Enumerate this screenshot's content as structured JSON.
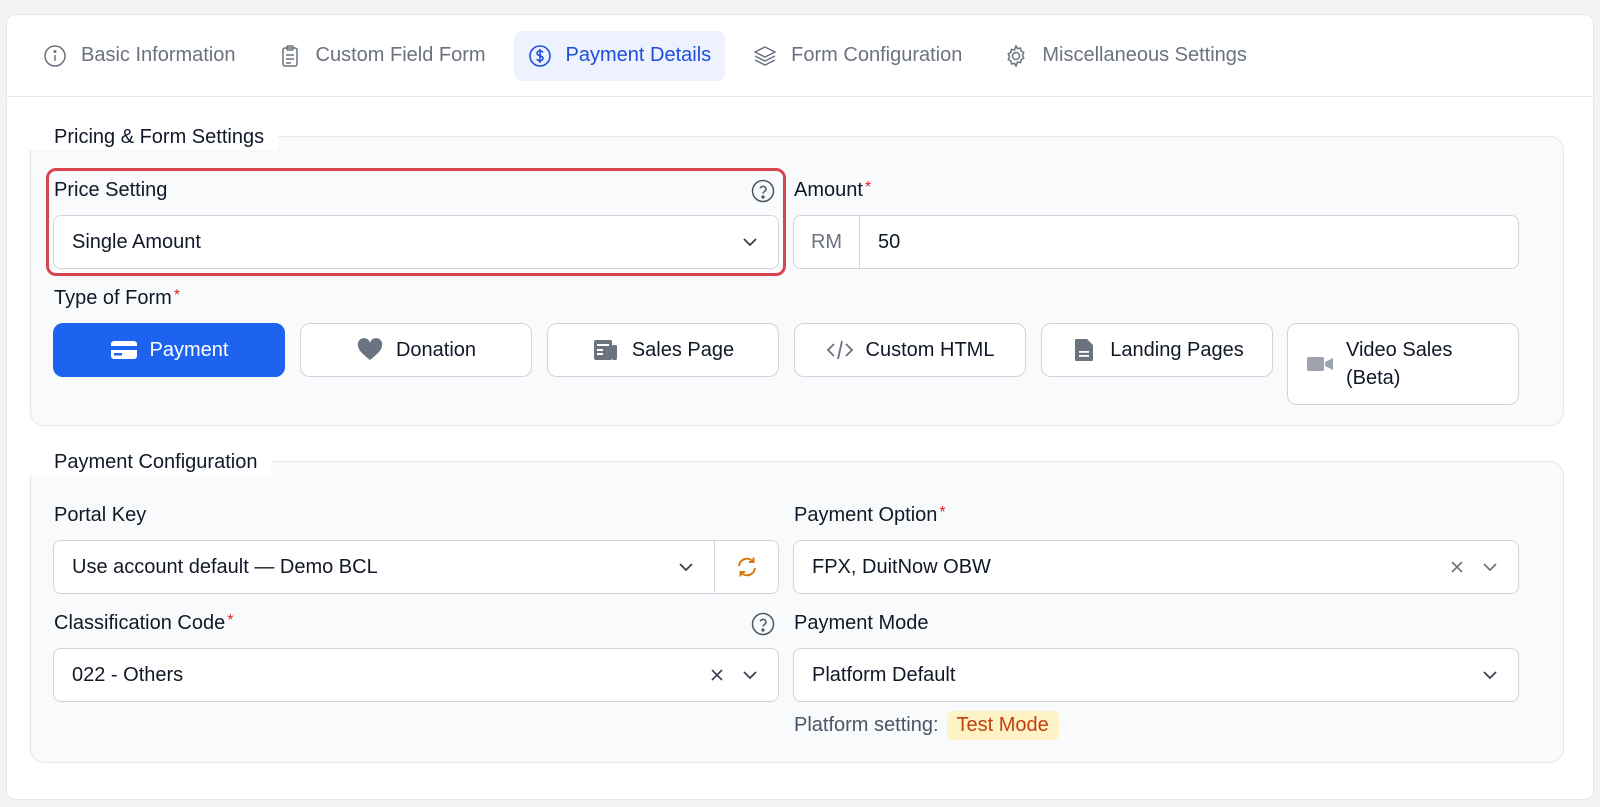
{
  "tabs": [
    {
      "label": "Basic Information",
      "icon": "info-icon"
    },
    {
      "label": "Custom Field Form",
      "icon": "clipboard-icon"
    },
    {
      "label": "Payment Details",
      "icon": "dollar-circle-icon",
      "active": true
    },
    {
      "label": "Form Configuration",
      "icon": "layers-icon"
    },
    {
      "label": "Miscellaneous Settings",
      "icon": "gear-icon"
    }
  ],
  "pricing": {
    "legend": "Pricing & Form Settings",
    "price_setting_label": "Price Setting",
    "price_setting_value": "Single Amount",
    "amount_label": "Amount",
    "amount_prefix": "RM",
    "amount_value": "50",
    "required_mark": "*",
    "type_label": "Type of Form",
    "types": [
      {
        "label": "Payment",
        "icon": "card-icon",
        "active": true
      },
      {
        "label": "Donation",
        "icon": "heart-icon"
      },
      {
        "label": "Sales Page",
        "icon": "newspaper-icon"
      },
      {
        "label": "Custom HTML",
        "icon": "code-icon"
      },
      {
        "label": "Landing Pages",
        "icon": "file-icon"
      },
      {
        "label": "Video Sales",
        "label2": "(Beta)",
        "icon": "video-icon"
      }
    ]
  },
  "payment": {
    "legend": "Payment Configuration",
    "portal_key_label": "Portal Key",
    "portal_key_value": "Use account default — Demo BCL",
    "payment_option_label": "Payment Option",
    "payment_option_value": "FPX, DuitNow OBW",
    "classification_label": "Classification Code",
    "classification_value": "022 - Others",
    "payment_mode_label": "Payment Mode",
    "payment_mode_value": "Platform Default",
    "platform_setting_label": "Platform setting:",
    "platform_setting_badge": "Test Mode"
  },
  "colors": {
    "accent": "#1d63ef",
    "active_tab": "#1d4ed8",
    "highlight": "#d9454f",
    "required": "#dc2626",
    "badge_bg": "#fef3c7",
    "badge_text": "#c2410c",
    "refresh_icon": "#d97706"
  }
}
